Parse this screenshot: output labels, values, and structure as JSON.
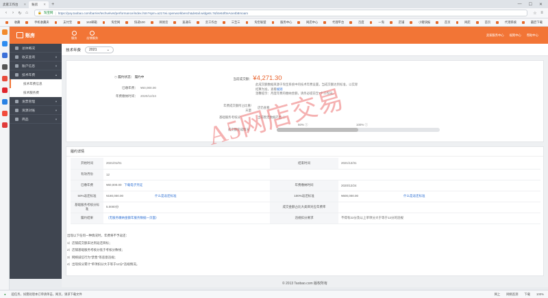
{
  "browser": {
    "tabs": [
      {
        "label": "卖家工作台",
        "active": false
      },
      {
        "label": "账房",
        "active": true
      }
    ],
    "address": {
      "secure_label": "淘宝网",
      "url": "https://pay.taobao.com/barrier/techvelvet/performance/index.htm?spm=a217wi.openworkbench&detail.widgets.7&f4e64f0eAoe4b8moam"
    },
    "bookmarks": [
      "收藏",
      "手机收藏夹",
      "支付宝",
      "163邮箱",
      "淘宝网",
      "快递100",
      "网易云",
      "直通车",
      "云工作台",
      "三至三",
      "淘宝联盟",
      "服务中心",
      "网店中心",
      "代理平台",
      "百度",
      "一淘",
      "店铺",
      "小猪快报",
      "首页",
      "网店",
      "首页",
      "代理系统",
      "最后下载"
    ],
    "status_text": "超任务，如需处理本订单请单击，网页，请求下载文件",
    "status_right": [
      "网上",
      "网络监测",
      "下载",
      "100%"
    ]
  },
  "header": {
    "logo_text": "账房",
    "nav": [
      {
        "label": "服务"
      },
      {
        "label": "店铺服务"
      }
    ],
    "right_links": [
      "卖家服务中心",
      "规则中心",
      "帮助中心"
    ]
  },
  "sidebar": {
    "items": [
      {
        "label": "总体概况",
        "has_children": false
      },
      {
        "label": "收支查询",
        "has_children": true
      },
      {
        "label": "账户信息",
        "has_children": true
      },
      {
        "label": "技术年费",
        "has_children": true,
        "children": [
          {
            "label": "技术年费信息",
            "active": true
          },
          {
            "label": "技术服务费",
            "active": false
          }
        ]
      },
      {
        "label": "发票管理",
        "has_children": true
      },
      {
        "label": "资源对账",
        "has_children": true
      },
      {
        "label": "商品",
        "has_children": true
      }
    ]
  },
  "year_filter": {
    "label": "技术年费",
    "value": "2021"
  },
  "summary": {
    "status_label": "履约状态：",
    "status_value": "履约中",
    "paid_label": "已缴年费：",
    "paid_value": "¥60,000.00",
    "date_label": "年费缴纳时间：",
    "date_value": "2020/12/24",
    "current_sales_label": "当前成交额：",
    "current_sales_value": "¥4,271.30",
    "desc_line1": "此成交额数据来源于淘宝系统中的技术年费设置，当成交额达到标准，以实际",
    "desc_line2": "结算为准，查看",
    "desc_link": "规则",
    "desc_line3": "温馨提示：月度年费的缴纳金额，请务必提前至7个工作日。",
    "refund_label": "年费成交额所占比重/天量",
    "refund_value": "店仍查看",
    "level_label": "基础服务考核分：",
    "level_value": "当前暂无数据产出",
    "progress_label": "成交额完成情况",
    "progress_marks": [
      "50%",
      "100%"
    ],
    "progress_value": 0.5
  },
  "detail": {
    "title": "履约详情",
    "rows": [
      [
        {
          "label": "开始时间",
          "value": "2021/01/01"
        },
        {
          "label": "结束时间",
          "value": "2021/12/31"
        }
      ],
      [
        {
          "label": "有效月份",
          "value": "12"
        }
      ],
      [
        {
          "label": "已缴年费",
          "value": "¥60,000.00",
          "link": "下载电子凭证"
        },
        {
          "label": "年费缴纳时间",
          "value": "2020/12/24"
        }
      ],
      [
        {
          "label": "50%返还标准",
          "value": "¥180,000.00",
          "link": "什么是返还标准"
        },
        {
          "label": "100%返还标准",
          "value": "¥600,000.00",
          "link": "什么是返还标准"
        }
      ],
      [
        {
          "label": "基础服务考核分标准",
          "value": "5.0000分"
        },
        {
          "label": "成交金额占比大类目对应年费率",
          "value": ""
        }
      ],
      [
        {
          "label": "履约结果",
          "value": "（无服务缴纳金额年服务数据一页面）"
        },
        {
          "label": "违规扣分要求",
          "value": "不得有22分及以上单项分大于等于12分的违规"
        }
      ]
    ],
    "notes_title": "出现以下任何一种情况时，年费将不予返还：",
    "notes": [
      "1）店铺成交额未达到返还目标；",
      "2）店铺基础服务考核分低于考核分数线；",
      "3）网络诚信行为\"禁售\"等恶意违规；",
      "4）出现扣分累计\"单项扣分大于等于12分\"违规情况。"
    ]
  },
  "footer": {
    "text": "© 2013 Taobao.com 版权所有"
  },
  "watermark": {
    "text": "A5网店交易"
  },
  "colors": {
    "brand": "#f27536",
    "sidebar": "#3f4550",
    "price": "#e8622c",
    "link": "#2d6fd3",
    "watermark": "#e64646"
  }
}
